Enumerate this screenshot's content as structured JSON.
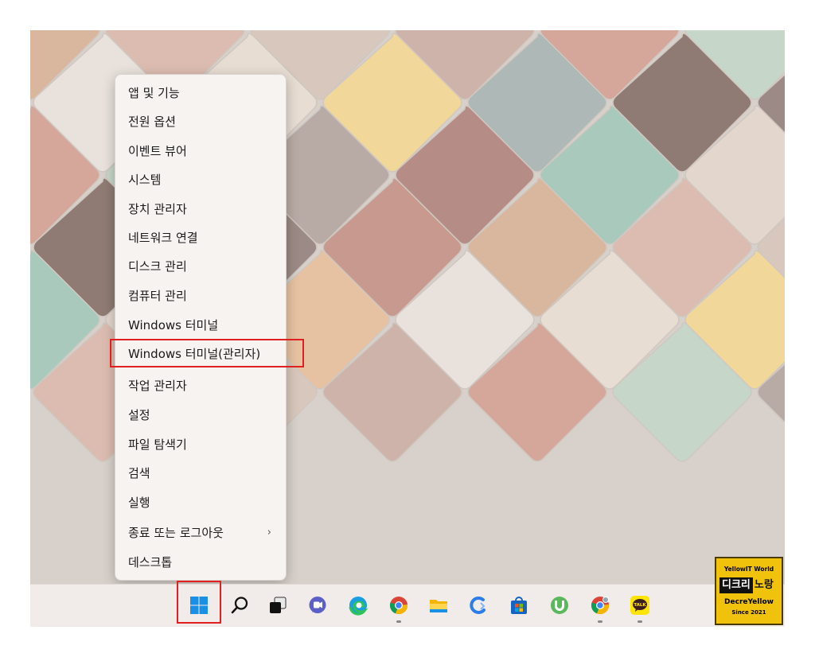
{
  "palette": {
    "tiles": [
      "#e3d6cd",
      "#d4a79a",
      "#c89a8f",
      "#e8ddd3",
      "#b68d86",
      "#d8c7bc",
      "#8f7b74",
      "#e6c2a2",
      "#c6d7c9",
      "#d9b79f",
      "#f1d79a",
      "#a9c9bd",
      "#cdb3a9",
      "#9c8a86",
      "#e9e2dc",
      "#b8aaa5",
      "#dcbcb0",
      "#aeb8b7"
    ],
    "highlight": "#e02020",
    "taskbar": "#f1ebe9"
  },
  "context_menu": {
    "items": [
      {
        "label": "앱 및 기능"
      },
      {
        "label": "전원 옵션"
      },
      {
        "label": "이벤트 뷰어"
      },
      {
        "label": "시스템"
      },
      {
        "label": "장치 관리자"
      },
      {
        "label": "네트워크 연결"
      },
      {
        "label": "디스크 관리"
      },
      {
        "label": "컴퓨터 관리"
      },
      {
        "label": "Windows 터미널"
      },
      {
        "label": "Windows 터미널(관리자)"
      },
      {
        "label": "작업 관리자"
      },
      {
        "label": "설정"
      },
      {
        "label": "파일 탐색기"
      },
      {
        "label": "검색"
      },
      {
        "label": "실행"
      },
      {
        "label": "종료 또는 로그아웃",
        "submenu_chevron": "›"
      },
      {
        "label": "데스크톱"
      }
    ]
  },
  "taskbar": {
    "icons": [
      "windows-start-icon",
      "search-icon",
      "task-view-icon",
      "chat-icon",
      "edge-icon",
      "chrome-icon",
      "file-explorer-icon",
      "ccleaner-icon",
      "store-icon",
      "utorrent-icon",
      "chrome-dev-icon",
      "kakaotalk-icon"
    ],
    "kakaotalk_label": "TALK"
  },
  "watermark": {
    "top": "YellowIT World",
    "kr_1": "디크리",
    "kr_2": "노랑",
    "brand": "DecreYellow",
    "since": "Since 2021"
  }
}
